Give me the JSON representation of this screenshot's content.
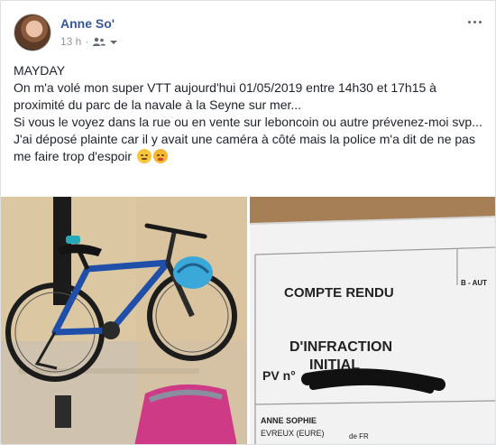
{
  "post": {
    "author": "Anne So'",
    "time": "13 h",
    "separator": "·",
    "lines": [
      "MAYDAY",
      "On m'a volé mon super VTT aujourd'hui 01/05/2019 entre 14h30 et 17h15 à proximité du parc de la navale à la Seyne sur mer...",
      "Si vous le voyez dans la rue ou en vente sur leboncoin ou autre prévenez-moi svp...",
      "J'ai déposé plainte car il y avait une caméra à côté mais la police m'a dit de ne pas me faire trop d'espoir"
    ]
  },
  "icons": {
    "audience": "friends-icon",
    "more": "more-options-icon",
    "emoji_1": "sleepy-face-icon",
    "emoji_2": "grimacing-face-icon"
  },
  "document": {
    "title_1": "COMPTE RENDU",
    "title_2": "D'INFRACTION",
    "title_3": "INITIAL",
    "pv": "PV n°",
    "corner": "B - AUT",
    "name": "ANNE SOPHIE",
    "place": "EVREUX (EURE)",
    "tail": "de FR"
  },
  "colors": {
    "author": "#365899",
    "bike": "#1f4fa8",
    "helmet": "#3aa8d8"
  }
}
